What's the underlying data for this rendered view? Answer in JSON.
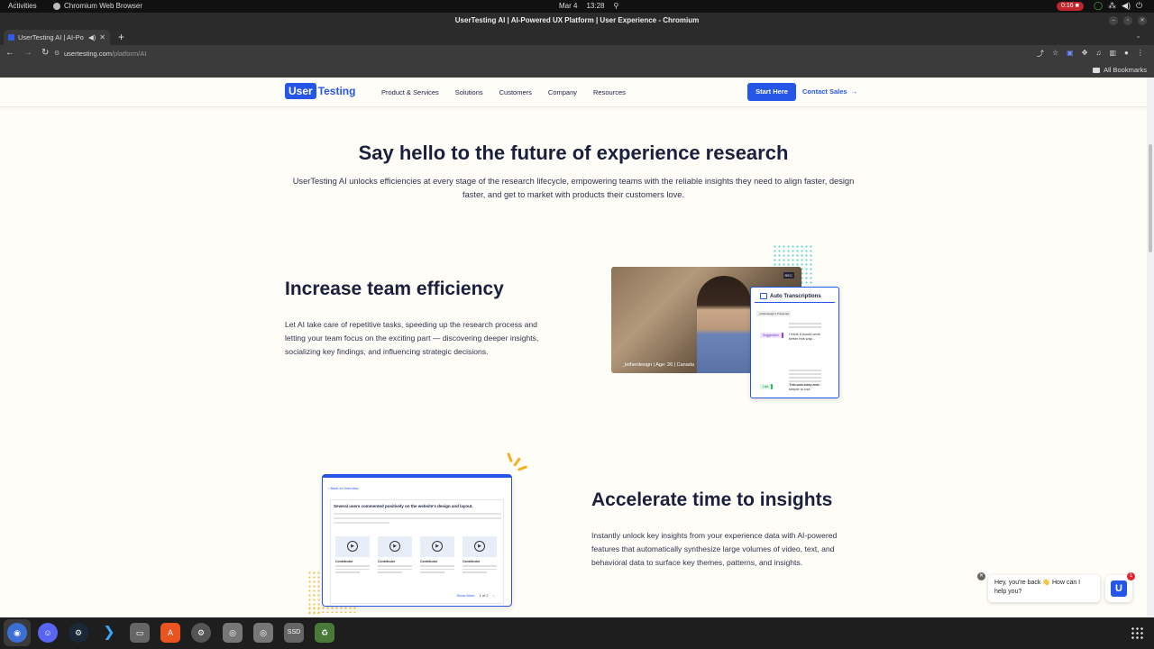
{
  "system": {
    "activities": "Activities",
    "app_name": "Chromium Web Browser",
    "date": "Mar 4",
    "time": "13:28",
    "recording": "0:16"
  },
  "window": {
    "title": "UserTesting AI | AI-Powered UX Platform | User Experience - Chromium"
  },
  "tab": {
    "title": "UserTesting AI | AI-Po"
  },
  "address": {
    "host": "usertesting.com",
    "path": "/platform/AI"
  },
  "bookmarks": {
    "all_label": "All Bookmarks"
  },
  "site": {
    "logo_user": "User",
    "logo_testing": "Testing",
    "nav": [
      "Product & Services",
      "Solutions",
      "Customers",
      "Company",
      "Resources"
    ],
    "start_here": "Start Here",
    "contact_sales": "Contact Sales",
    "brand_color": "#2656e8"
  },
  "hero": {
    "title": "Say hello to the future of experience research",
    "subtitle": "UserTesting AI unlocks efficiencies at every stage of the research lifecycle, empowering teams with the reliable insights they need to align faster, design faster, and get to market with products their customers love."
  },
  "section1": {
    "title": "Increase team efficiency",
    "body": "Let AI take care of repetitive tasks, speeding up the research process and letting your team focus on the exciting part — discovering deeper insights, socializing key findings, and influencing strategic decisions.",
    "video_meta": "_letherdesign  |  Age: 26  |  Canada",
    "rec_label": "REC",
    "transcript": {
      "title": "Auto Transcriptions",
      "user": "_letherdesign's Transcript",
      "tag1": "Suggestion",
      "quote1": "I think it would work better this way...",
      "tag2": "Like",
      "quote2": "This was easy and simple to use."
    }
  },
  "section2": {
    "title": "Accelerate time to insights",
    "body": "Instantly unlock key insights from your experience data with AI-powered features that automatically synthesize large volumes of video, text, and behavioral data to surface key themes, patterns, and insights.",
    "overview": {
      "back": "Back to Overview",
      "headline": "Several users commented positively on the website's design and layout.",
      "clip_label": "Contributor",
      "show_more": "Show More",
      "pager": "1 of 2"
    }
  },
  "chat": {
    "message": "Hey, you're back 👋 How can I help you?",
    "badge": "1",
    "launcher": "U"
  }
}
